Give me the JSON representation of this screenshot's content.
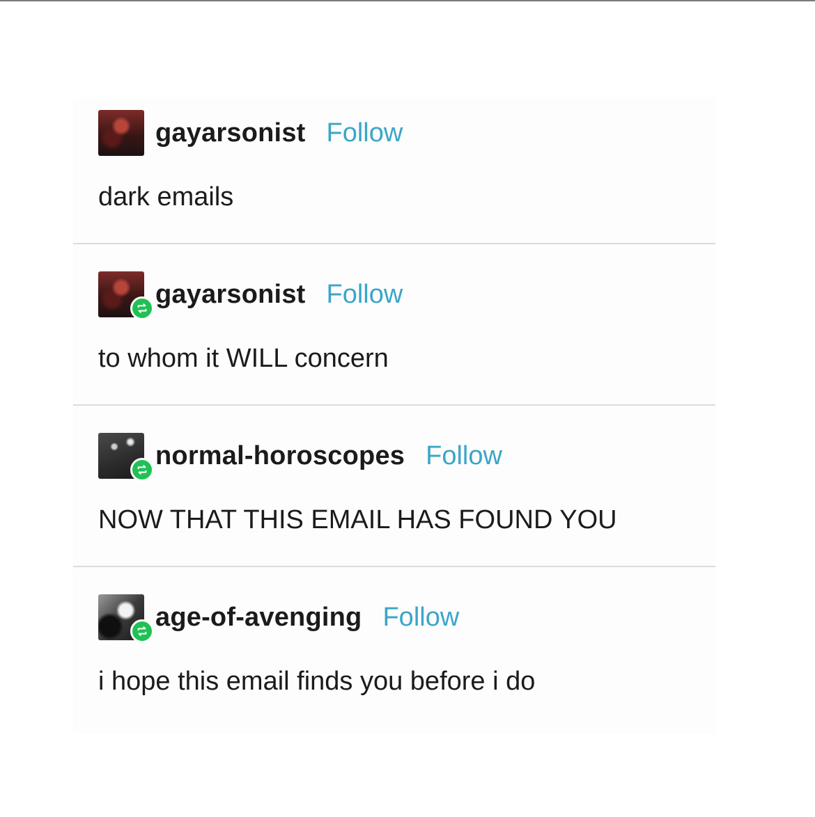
{
  "posts": [
    {
      "username": "gayarsonist",
      "follow_label": "Follow",
      "text": "dark emails",
      "avatar_icon": "avatar-dark-red",
      "is_reblog": false
    },
    {
      "username": "gayarsonist",
      "follow_label": "Follow",
      "text": "to whom it WILL concern",
      "avatar_icon": "avatar-dark-red",
      "is_reblog": true
    },
    {
      "username": "normal-horoscopes",
      "follow_label": "Follow",
      "text": "NOW THAT THIS EMAIL HAS FOUND YOU",
      "avatar_icon": "avatar-gray",
      "is_reblog": true
    },
    {
      "username": "age-of-avenging",
      "follow_label": "Follow",
      "text": "i hope this email finds you before i do",
      "avatar_icon": "avatar-bw",
      "is_reblog": true
    }
  ],
  "colors": {
    "follow": "#3aa6c7",
    "reblog_badge": "#1fc155",
    "text": "#1b1b1b",
    "divider": "#dcdcdc"
  }
}
